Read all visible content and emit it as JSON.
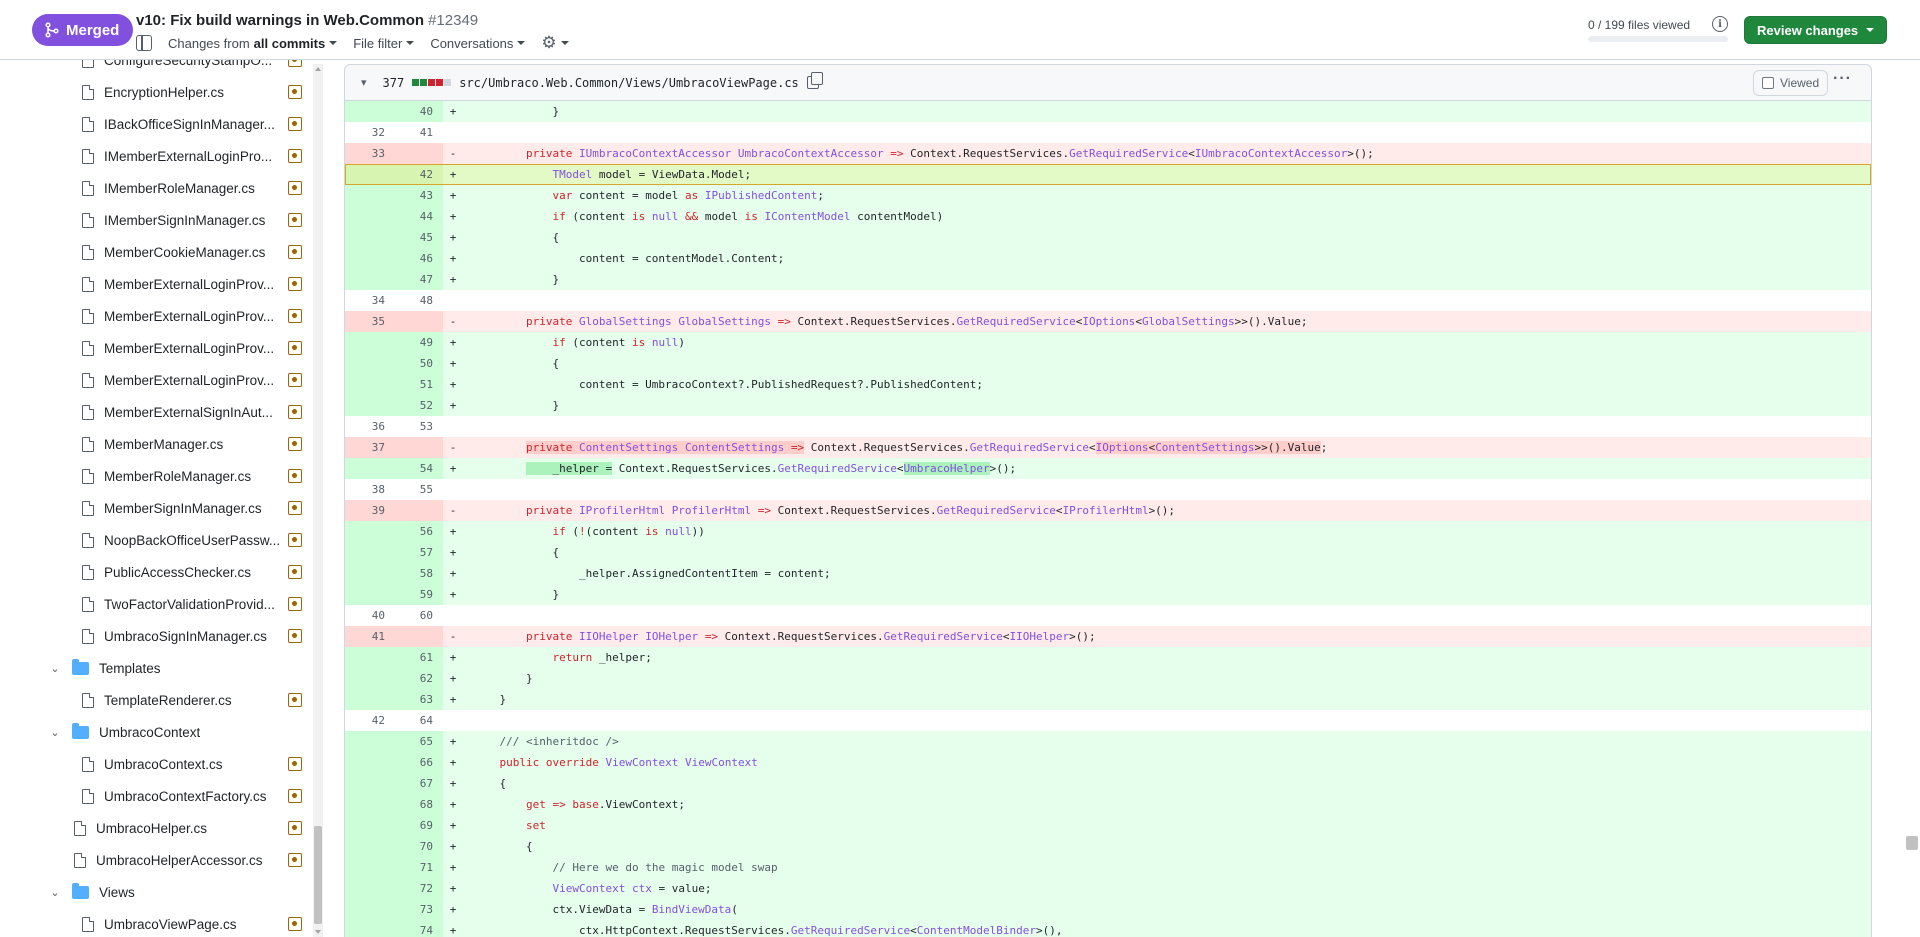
{
  "header": {
    "status_label": "Merged",
    "title": "v10: Fix build warnings in Web.Common",
    "number": "#12349",
    "changes_from_prefix": "Changes from",
    "changes_from_value": "all commits",
    "file_filter": "File filter",
    "conversations": "Conversations",
    "files_viewed": "0 / 199 files viewed",
    "review_button": "Review changes"
  },
  "colors": {
    "merged": "#8250df",
    "review": "#1f883d",
    "addition_bg": "#e6ffec",
    "deletion_bg": "#ffebe9"
  },
  "sidebar": {
    "items": [
      {
        "type": "file",
        "label": "ConfigureSecurityStampO...",
        "indent": 1
      },
      {
        "type": "file",
        "label": "EncryptionHelper.cs",
        "indent": 1
      },
      {
        "type": "file",
        "label": "IBackOfficeSignInManager...",
        "indent": 1
      },
      {
        "type": "file",
        "label": "IMemberExternalLoginPro...",
        "indent": 1
      },
      {
        "type": "file",
        "label": "IMemberRoleManager.cs",
        "indent": 1
      },
      {
        "type": "file",
        "label": "IMemberSignInManager.cs",
        "indent": 1
      },
      {
        "type": "file",
        "label": "MemberCookieManager.cs",
        "indent": 1
      },
      {
        "type": "file",
        "label": "MemberExternalLoginProv...",
        "indent": 1
      },
      {
        "type": "file",
        "label": "MemberExternalLoginProv...",
        "indent": 1
      },
      {
        "type": "file",
        "label": "MemberExternalLoginProv...",
        "indent": 1
      },
      {
        "type": "file",
        "label": "MemberExternalLoginProv...",
        "indent": 1
      },
      {
        "type": "file",
        "label": "MemberExternalSignInAut...",
        "indent": 1
      },
      {
        "type": "file",
        "label": "MemberManager.cs",
        "indent": 1
      },
      {
        "type": "file",
        "label": "MemberRoleManager.cs",
        "indent": 1
      },
      {
        "type": "file",
        "label": "MemberSignInManager.cs",
        "indent": 1
      },
      {
        "type": "file",
        "label": "NoopBackOfficeUserPassw...",
        "indent": 1
      },
      {
        "type": "file",
        "label": "PublicAccessChecker.cs",
        "indent": 1
      },
      {
        "type": "file",
        "label": "TwoFactorValidationProvid...",
        "indent": 1
      },
      {
        "type": "file",
        "label": "UmbracoSignInManager.cs",
        "indent": 1
      },
      {
        "type": "folder",
        "label": "Templates",
        "indent": 0
      },
      {
        "type": "file",
        "label": "TemplateRenderer.cs",
        "indent": 1
      },
      {
        "type": "folder",
        "label": "UmbracoContext",
        "indent": 0
      },
      {
        "type": "file",
        "label": "UmbracoContext.cs",
        "indent": 1
      },
      {
        "type": "file",
        "label": "UmbracoContextFactory.cs",
        "indent": 1
      },
      {
        "type": "file",
        "label": "UmbracoHelper.cs",
        "indent": 0
      },
      {
        "type": "file",
        "label": "UmbracoHelperAccessor.cs",
        "indent": 0
      },
      {
        "type": "folder",
        "label": "Views",
        "indent": 0
      },
      {
        "type": "file",
        "label": "UmbracoViewPage.cs",
        "indent": 1
      }
    ]
  },
  "file": {
    "changes": "377",
    "path": "src/Umbraco.Web.Common/Views/UmbracoViewPage.cs",
    "viewed_label": "Viewed"
  },
  "diff": [
    {
      "k": "add",
      "o": "",
      "n": "40",
      "s": "+",
      "h": "            }"
    },
    {
      "k": "ctx",
      "o": "32",
      "n": "41",
      "s": "",
      "h": ""
    },
    {
      "k": "del",
      "o": "33",
      "n": "",
      "s": "-",
      "h": "        <span class=\"kw\">private</span> <span class=\"ty\">IUmbracoContextAccessor</span> <span class=\"ty\">UmbracoContextAccessor</span> <span class=\"kw\">=></span> Context.RequestServices.<span class=\"fn\">GetRequiredService</span>&lt;<span class=\"ty\">IUmbracoContextAccessor</span>&gt;();"
    },
    {
      "k": "add hl",
      "o": "",
      "n": "42",
      "s": "+",
      "h": "            <span class=\"ty\">TModel</span> model = ViewData.Model;"
    },
    {
      "k": "add",
      "o": "",
      "n": "43",
      "s": "+",
      "h": "            <span class=\"kw\">var</span> content = model <span class=\"kw\">as</span> <span class=\"ty\">IPublishedContent</span>;"
    },
    {
      "k": "add",
      "o": "",
      "n": "44",
      "s": "+",
      "h": "            <span class=\"kw\">if</span> (content <span class=\"kw\">is</span> <span class=\"ty\">null</span> <span class=\"kw\">&amp;&amp;</span> model <span class=\"kw\">is</span> <span class=\"ty\">IContentModel</span> contentModel)"
    },
    {
      "k": "add",
      "o": "",
      "n": "45",
      "s": "+",
      "h": "            {"
    },
    {
      "k": "add",
      "o": "",
      "n": "46",
      "s": "+",
      "h": "                content = contentModel.Content;"
    },
    {
      "k": "add",
      "o": "",
      "n": "47",
      "s": "+",
      "h": "            }"
    },
    {
      "k": "ctx",
      "o": "34",
      "n": "48",
      "s": "",
      "h": ""
    },
    {
      "k": "del",
      "o": "35",
      "n": "",
      "s": "-",
      "h": "        <span class=\"kw\">private</span> <span class=\"ty\">GlobalSettings</span> <span class=\"ty\">GlobalSettings</span> <span class=\"kw\">=></span> Context.RequestServices.<span class=\"fn\">GetRequiredService</span>&lt;<span class=\"ty\">IOptions</span>&lt;<span class=\"ty\">GlobalSettings</span>&gt;&gt;().Value;"
    },
    {
      "k": "add",
      "o": "",
      "n": "49",
      "s": "+",
      "h": "            <span class=\"kw\">if</span> (content <span class=\"kw\">is</span> <span class=\"ty\">null</span>)"
    },
    {
      "k": "add",
      "o": "",
      "n": "50",
      "s": "+",
      "h": "            {"
    },
    {
      "k": "add",
      "o": "",
      "n": "51",
      "s": "+",
      "h": "                content = UmbracoContext?.PublishedRequest?.PublishedContent;"
    },
    {
      "k": "add",
      "o": "",
      "n": "52",
      "s": "+",
      "h": "            }"
    },
    {
      "k": "ctx",
      "o": "36",
      "n": "53",
      "s": "",
      "h": ""
    },
    {
      "k": "del",
      "o": "37",
      "n": "",
      "s": "-",
      "h": "        <span style=\"background:#ffcecb\"><span class=\"kw\">private</span> <span class=\"ty\">ContentSettings</span> <span class=\"ty\">ContentSettings</span> <span class=\"kw\">=></span></span> Context.RequestServices.<span class=\"fn\">GetRequiredService</span>&lt;<span style=\"background:#ffcecb\"><span class=\"ty\">IOptions</span>&lt;<span class=\"ty\">ContentSettings</span>&gt;&gt;().Value</span>;"
    },
    {
      "k": "add",
      "o": "",
      "n": "54",
      "s": "+",
      "h": "        <span style=\"background:#abf2bc\">    _helper =</span> Context.RequestServices.<span class=\"fn\">GetRequiredService</span>&lt;<span style=\"background:#abf2bc\"><span class=\"ty\">UmbracoHelper</span></span>&gt;();"
    },
    {
      "k": "ctx",
      "o": "38",
      "n": "55",
      "s": "",
      "h": ""
    },
    {
      "k": "del",
      "o": "39",
      "n": "",
      "s": "-",
      "h": "        <span class=\"kw\">private</span> <span class=\"ty\">IProfilerHtml</span> <span class=\"ty\">ProfilerHtml</span> <span class=\"kw\">=></span> Context.RequestServices.<span class=\"fn\">GetRequiredService</span>&lt;<span class=\"ty\">IProfilerHtml</span>&gt;();"
    },
    {
      "k": "add",
      "o": "",
      "n": "56",
      "s": "+",
      "h": "            <span class=\"kw\">if</span> (<span class=\"kw\">!</span>(content <span class=\"kw\">is</span> <span class=\"ty\">null</span>))"
    },
    {
      "k": "add",
      "o": "",
      "n": "57",
      "s": "+",
      "h": "            {"
    },
    {
      "k": "add",
      "o": "",
      "n": "58",
      "s": "+",
      "h": "                _helper.AssignedContentItem = content;"
    },
    {
      "k": "add",
      "o": "",
      "n": "59",
      "s": "+",
      "h": "            }"
    },
    {
      "k": "ctx",
      "o": "40",
      "n": "60",
      "s": "",
      "h": ""
    },
    {
      "k": "del",
      "o": "41",
      "n": "",
      "s": "-",
      "h": "        <span class=\"kw\">private</span> <span class=\"ty\">IIOHelper</span> <span class=\"ty\">IOHelper</span> <span class=\"kw\">=></span> Context.RequestServices.<span class=\"fn\">GetRequiredService</span>&lt;<span class=\"ty\">IIOHelper</span>&gt;();"
    },
    {
      "k": "add",
      "o": "",
      "n": "61",
      "s": "+",
      "h": "            <span class=\"kw\">return</span> _helper;"
    },
    {
      "k": "add",
      "o": "",
      "n": "62",
      "s": "+",
      "h": "        }"
    },
    {
      "k": "add",
      "o": "",
      "n": "63",
      "s": "+",
      "h": "    }"
    },
    {
      "k": "ctx",
      "o": "42",
      "n": "64",
      "s": "",
      "h": ""
    },
    {
      "k": "add",
      "o": "",
      "n": "65",
      "s": "+",
      "h": "    <span class=\"cm\">/// &lt;inheritdoc /&gt;</span>"
    },
    {
      "k": "add",
      "o": "",
      "n": "66",
      "s": "+",
      "h": "    <span class=\"kw\">public</span> <span class=\"kw\">override</span> <span class=\"ty\">ViewContext</span> <span class=\"ty\">ViewContext</span>"
    },
    {
      "k": "add",
      "o": "",
      "n": "67",
      "s": "+",
      "h": "    {"
    },
    {
      "k": "add",
      "o": "",
      "n": "68",
      "s": "+",
      "h": "        <span class=\"kw\">get</span> <span class=\"kw\">=></span> <span class=\"kw\">base</span>.ViewContext;"
    },
    {
      "k": "add",
      "o": "",
      "n": "69",
      "s": "+",
      "h": "        <span class=\"kw\">set</span>"
    },
    {
      "k": "add",
      "o": "",
      "n": "70",
      "s": "+",
      "h": "        {"
    },
    {
      "k": "add",
      "o": "",
      "n": "71",
      "s": "+",
      "h": "            <span class=\"cm\">// Here we do the magic model swap</span>"
    },
    {
      "k": "add",
      "o": "",
      "n": "72",
      "s": "+",
      "h": "            <span class=\"ty\">ViewContext</span> <span class=\"ty\">ctx</span> = value;"
    },
    {
      "k": "add",
      "o": "",
      "n": "73",
      "s": "+",
      "h": "            ctx.ViewData = <span class=\"fn\">BindViewData</span>("
    },
    {
      "k": "add",
      "o": "",
      "n": "74",
      "s": "+",
      "h": "                ctx.HttpContext.RequestServices.<span class=\"fn\">GetRequiredService</span>&lt;<span class=\"ty\">ContentModelBinder</span>&gt;(),"
    }
  ]
}
